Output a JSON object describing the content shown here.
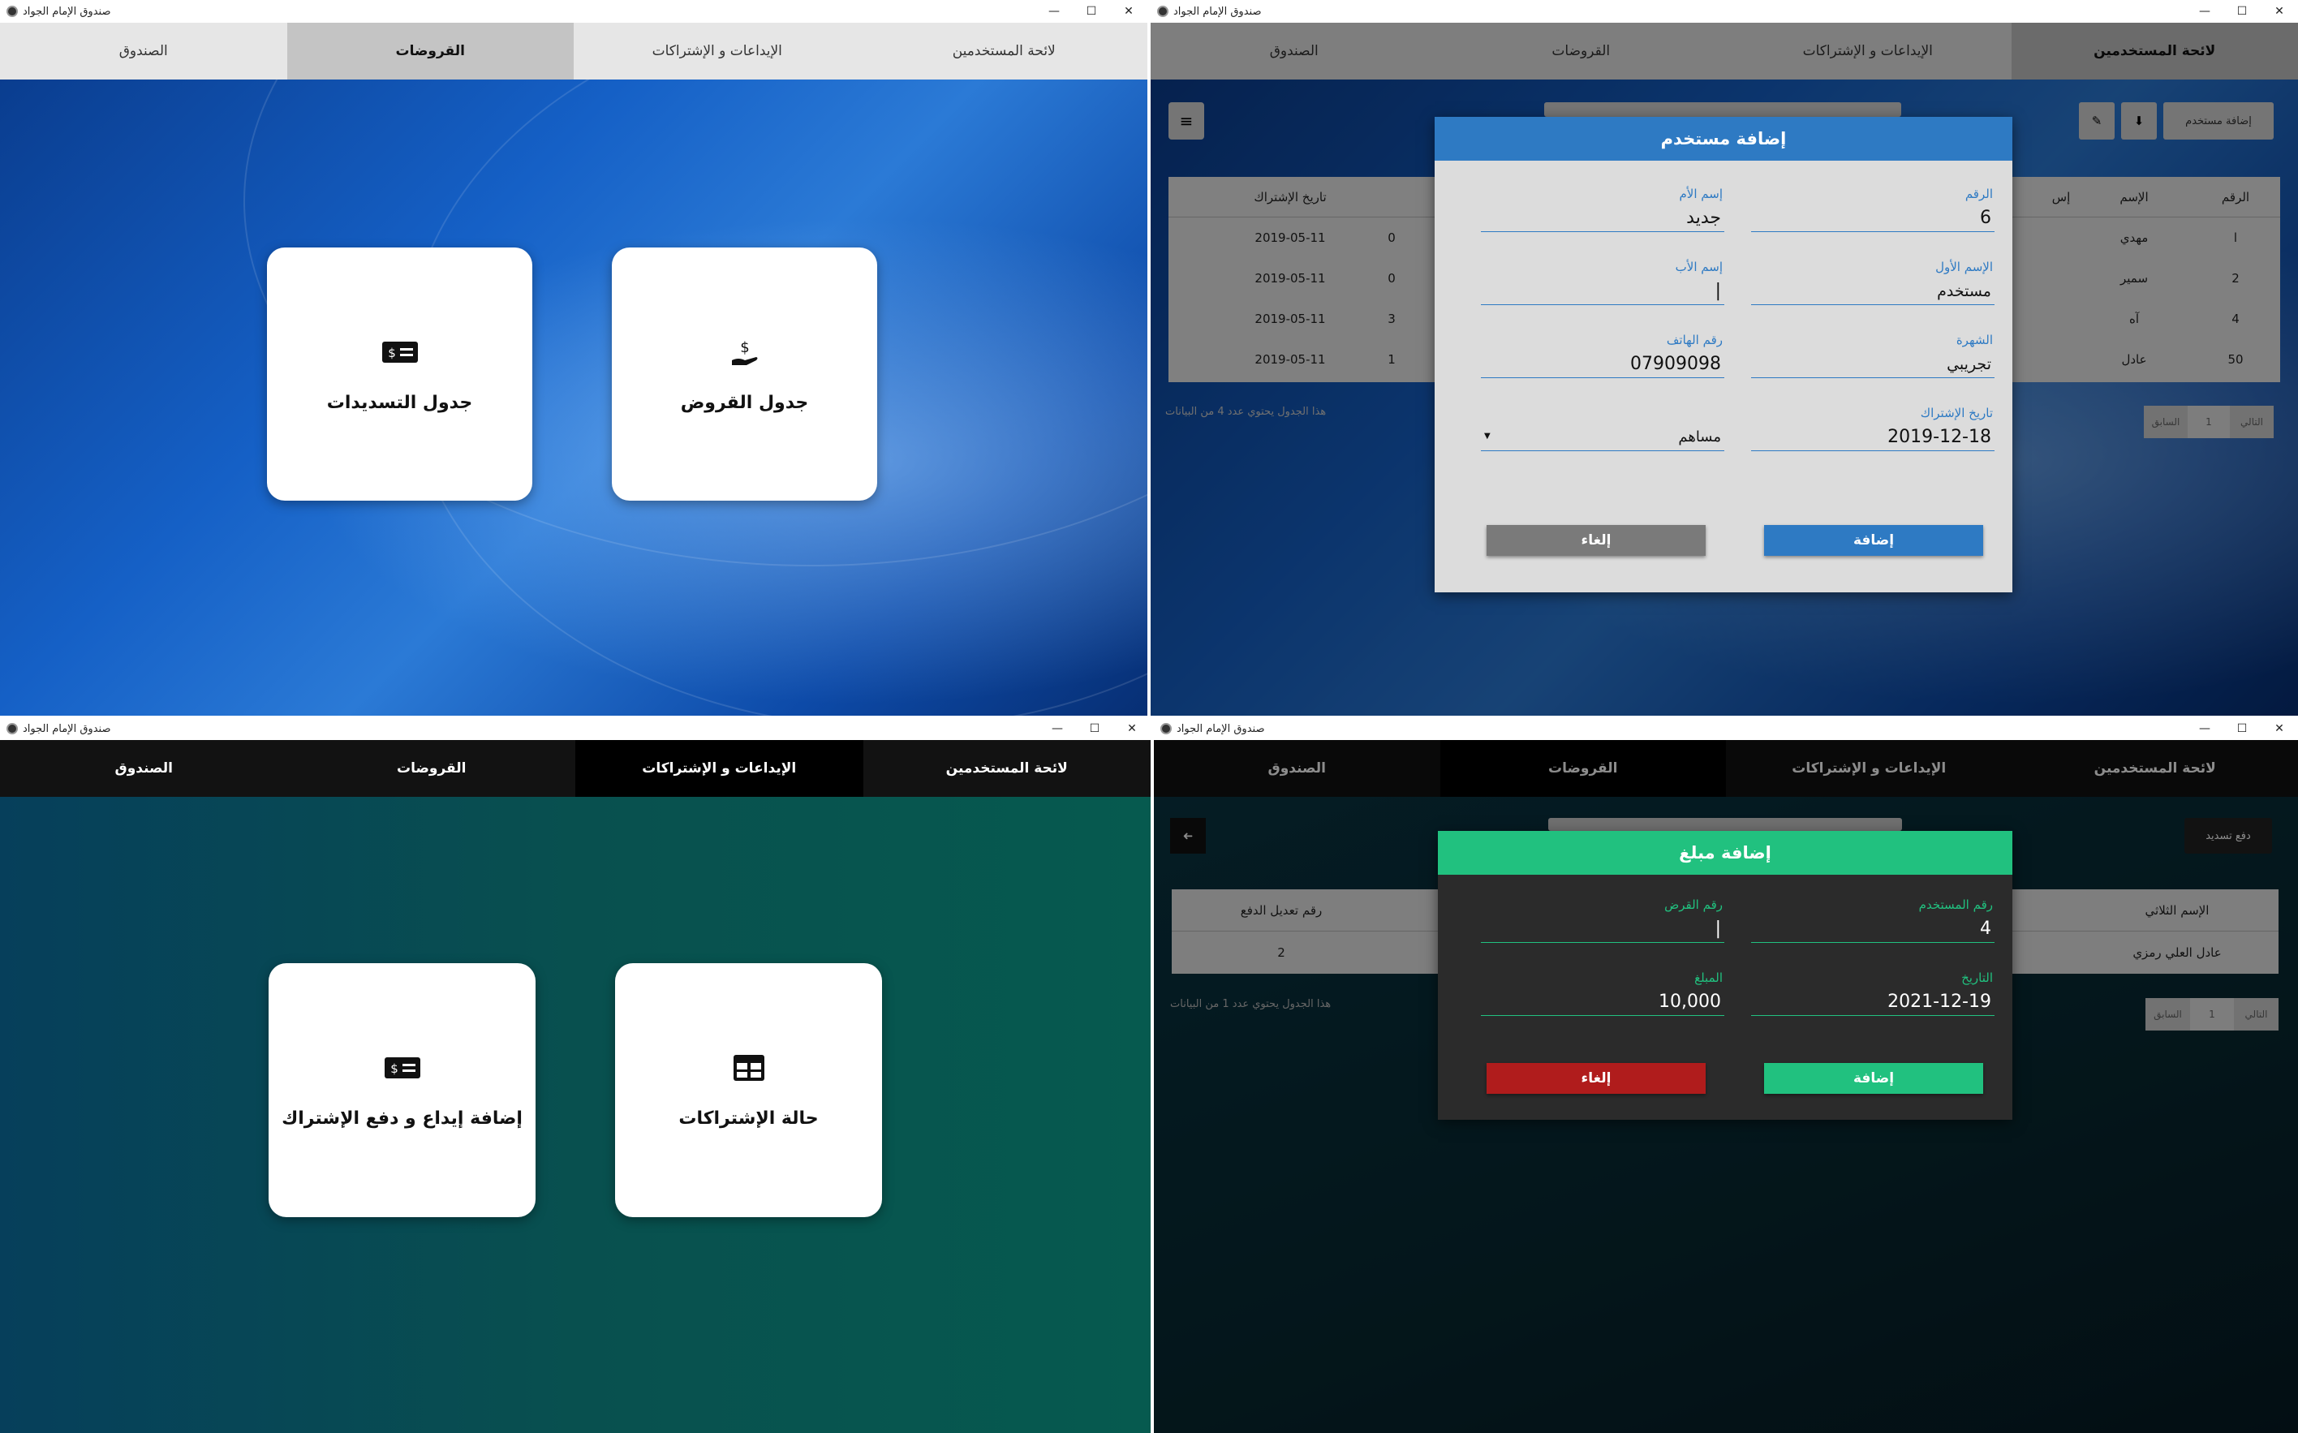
{
  "app": {
    "title": "صندوق الإمام الجواد",
    "min": "—",
    "max": "☐",
    "close": "✕"
  },
  "tabs": [
    "لائحة المستخدمين",
    "الإيداعات و الإشتراكات",
    "القروضات",
    "الصندوق"
  ],
  "screen1": {
    "cards": [
      {
        "label": "جدول القروض",
        "icon": "hand-money-icon",
        "glyph": "💲"
      },
      {
        "label": "جدول التسديدات",
        "icon": "money-bill-icon",
        "glyph": "$="
      }
    ]
  },
  "screen2": {
    "toolbar": {
      "add_user": "إضافة مستخدم",
      "download_glyph": "⬇",
      "edit_glyph": "✎",
      "db_glyph": "≡"
    },
    "table": {
      "headers": [
        "الرقم",
        "الإسم",
        "إس",
        "",
        "تاريخ الإشتراك"
      ],
      "rows": [
        [
          "ا",
          "مهدي",
          "2019-05-11",
          "0"
        ],
        [
          "2",
          "سمير",
          "2019-05-11",
          "0"
        ],
        [
          "4",
          "آه",
          "2019-05-11",
          "3"
        ],
        [
          "50",
          "عادل",
          "2019-05-11",
          "1"
        ]
      ],
      "footer": "هذا الجدول يحتوي عدد 4 من البيانات",
      "pager": [
        "التالي",
        "1",
        "السابق"
      ]
    },
    "dialog": {
      "title": "إضافة مستخدم",
      "fields": {
        "number_label": "الرقم",
        "number_value": "6",
        "mother_label": "إسم الأم",
        "mother_value": "جديد",
        "first_label": "الإسم الأول",
        "first_value": "مستخدم",
        "father_label": "إسم الأب",
        "father_value": "|",
        "surname_label": "الشهرة",
        "surname_value": "تجريبي",
        "phone_label": "رقم الهاتف",
        "phone_value": "07909098",
        "date_label": "تاريخ الإشتراك",
        "date_value": "2019-12-18",
        "type_value": "مساهم"
      },
      "add": "إضافة",
      "cancel": "إلغاء"
    }
  },
  "screen3": {
    "cards": [
      {
        "label": "حالة الإشتراكات",
        "icon": "table-grid-icon",
        "glyph": "⊞"
      },
      {
        "label": "إضافة إيداع و دفع الإشتراك",
        "icon": "money-bill-icon",
        "glyph": "$="
      }
    ]
  },
  "screen4": {
    "toolbar": {
      "pay": "دفع تسديد",
      "back_glyph": "➜"
    },
    "table": {
      "headers": [
        "الإسم الثلاثي",
        "رقم تعديل الدفع"
      ],
      "row": [
        "عادل العلي رمزي",
        "2"
      ],
      "footer": "هذا الجدول يحتوي عدد 1 من البيانات",
      "pager": [
        "التالي",
        "1",
        "السابق"
      ]
    },
    "dialog": {
      "title": "إضافة مبلغ",
      "fields": {
        "user_label": "رقم المستخدم",
        "user_value": "4",
        "loan_label": "رقم القرض",
        "loan_value": "|",
        "date_label": "التاريخ",
        "date_value": "2021-12-19",
        "amount_label": "المبلغ",
        "amount_value": "10,000"
      },
      "add": "إضافة",
      "cancel": "إلغاء"
    }
  }
}
